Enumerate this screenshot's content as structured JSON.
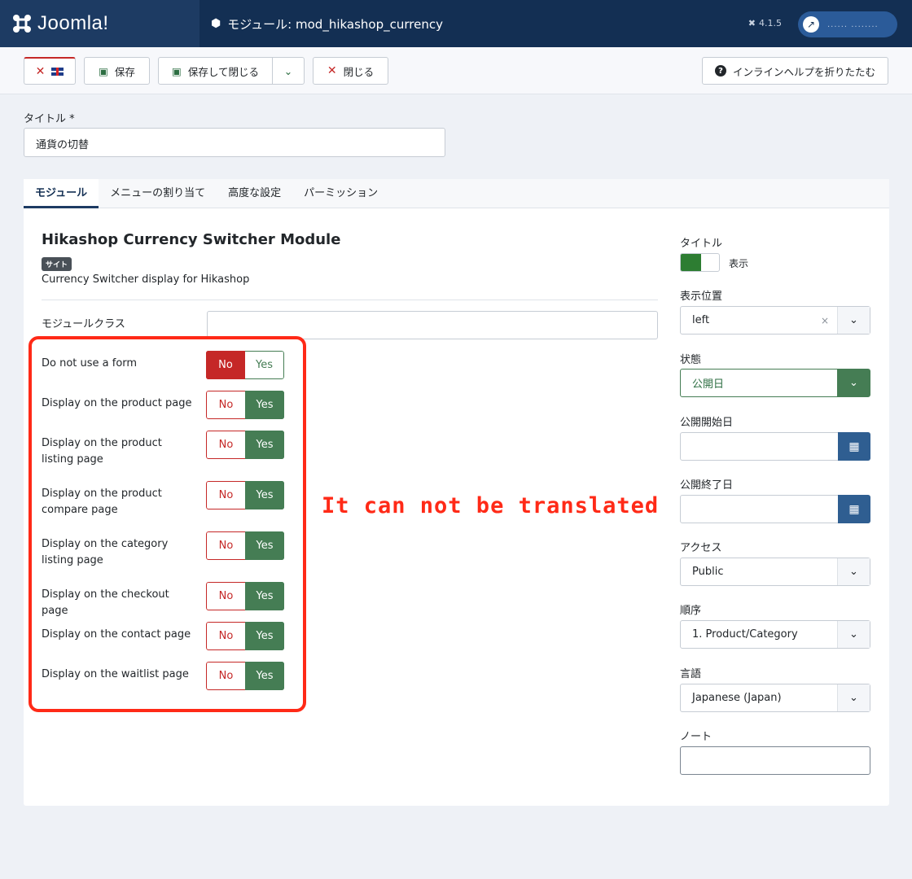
{
  "header": {
    "brand": "Joomla!",
    "page_title": "モジュール: mod_hikashop_currency",
    "version": "4.1.5",
    "user_name_masked": "...... ........"
  },
  "toolbar": {
    "save": "保存",
    "save_close": "保存して閉じる",
    "close": "閉じる",
    "help": "インラインヘルプを折りたたむ"
  },
  "title_field": {
    "label": "タイトル *",
    "value": "通貨の切替"
  },
  "tabs": [
    "モジュール",
    "メニューの割り当て",
    "高度な設定",
    "パーミッション"
  ],
  "module": {
    "name": "Hikashop Currency Switcher Module",
    "badge": "サイト",
    "description": "Currency Switcher display for Hikashop",
    "class_label": "モジュールクラス"
  },
  "options": [
    {
      "label": "Do not use a form",
      "value": "No"
    },
    {
      "label": "Display on the product page",
      "value": "Yes"
    },
    {
      "label": "Display on the product listing page",
      "value": "Yes"
    },
    {
      "label": "Display on the product compare page",
      "value": "Yes"
    },
    {
      "label": "Display on the category listing page",
      "value": "Yes"
    },
    {
      "label": "Display on the checkout page",
      "value": "Yes"
    },
    {
      "label": "Display on the contact page",
      "value": "Yes"
    },
    {
      "label": "Display on the waitlist page",
      "value": "Yes"
    }
  ],
  "switch_labels": {
    "no": "No",
    "yes": "Yes"
  },
  "annotation": "It can not be translated",
  "sidebar": {
    "title_label": "タイトル",
    "title_toggle": "表示",
    "position_label": "表示位置",
    "position_value": "left",
    "status_label": "状態",
    "status_value": "公開日",
    "publish_up_label": "公開開始日",
    "publish_down_label": "公開終了日",
    "access_label": "アクセス",
    "access_value": "Public",
    "ordering_label": "順序",
    "ordering_value": "1. Product/Category",
    "language_label": "言語",
    "language_value": "Japanese (Japan)",
    "note_label": "ノート"
  }
}
